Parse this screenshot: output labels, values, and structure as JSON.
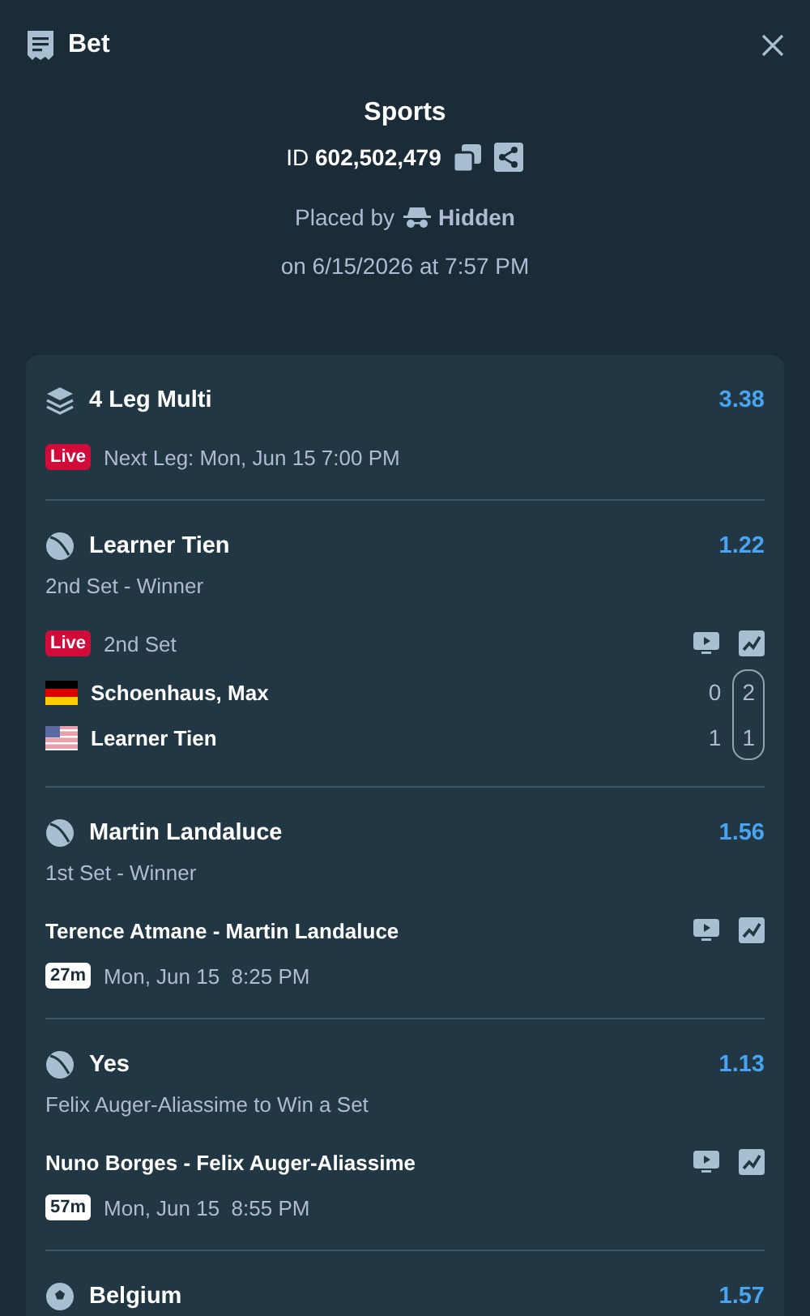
{
  "header": {
    "title": "Bet"
  },
  "summary": {
    "category": "Sports",
    "id_label": "ID",
    "id_value": "602,502,479",
    "placed_by_label": "Placed by",
    "placed_by_user": "Hidden",
    "placed_on": "on 6/15/2026 at 7:57 PM"
  },
  "multi": {
    "title": "4 Leg Multi",
    "odds": "3.38",
    "live_badge": "Live",
    "next_leg": "Next Leg: Mon, Jun 15 7:00 PM"
  },
  "legs": [
    {
      "kind": "live",
      "icon": {
        "kind": "tennis"
      },
      "selection": "Learner Tien",
      "odds": "1.22",
      "market": "2nd Set - Winner",
      "live_badge": "Live",
      "period": "2nd Set",
      "players": [
        {
          "flag": {
            "kind": "de"
          },
          "name": "Schoenhaus, Max",
          "game": "0",
          "set": "2"
        },
        {
          "flag": {
            "kind": "us"
          },
          "name": "Learner Tien",
          "game": "1",
          "set": "1"
        }
      ]
    },
    {
      "kind": "upcoming",
      "icon": {
        "kind": "tennis"
      },
      "selection": "Martin Landaluce",
      "odds": "1.56",
      "market": "1st Set - Winner",
      "match": "Terence Atmane - Martin Landaluce",
      "countdown": "27m",
      "start": "Mon, Jun 15  8:25 PM"
    },
    {
      "kind": "upcoming",
      "icon": {
        "kind": "tennis"
      },
      "selection": "Yes",
      "odds": "1.13",
      "market": "Felix Auger-Aliassime to Win a Set",
      "match": "Nuno Borges - Felix Auger-Aliassime",
      "countdown": "57m",
      "start": "Mon, Jun 15  8:55 PM"
    },
    {
      "kind": "cut",
      "icon": {
        "kind": "soccer"
      },
      "selection": "Belgium",
      "odds": "1.57"
    }
  ]
}
